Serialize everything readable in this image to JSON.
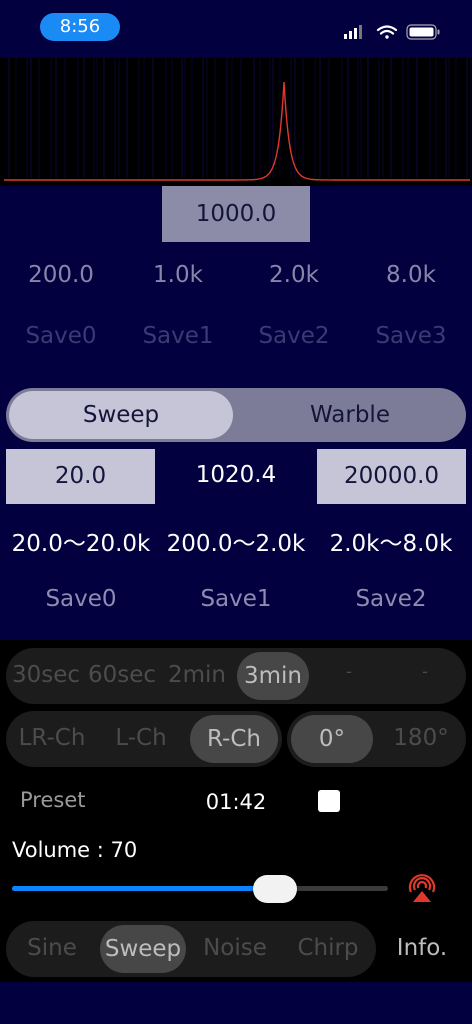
{
  "status": {
    "time": "8:56"
  },
  "spectrum": {
    "peak_frequency": 1000.0,
    "line_color": "#e0392b"
  },
  "tone": {
    "frequency": "1000.0",
    "presets": [
      "200.0",
      "1.0k",
      "2.0k",
      "8.0k"
    ],
    "saves": [
      "Save0",
      "Save1",
      "Save2",
      "Save3"
    ]
  },
  "sweep": {
    "tabs": [
      "Sweep",
      "Warble"
    ],
    "selected_tab": "Sweep",
    "start": "20.0",
    "current": "1020.4",
    "end": "20000.0",
    "ranges": [
      "20.0～20.0k",
      "200.0～2.0k",
      "2.0k～8.0k"
    ],
    "saves": [
      "Save0",
      "Save1",
      "Save2"
    ]
  },
  "duration": {
    "options": [
      "30sec",
      "60sec",
      "2min",
      "3min",
      "-",
      "-"
    ],
    "selected": "3min"
  },
  "channel": {
    "options": [
      "LR-Ch",
      "L-Ch",
      "R-Ch"
    ],
    "selected": "R-Ch"
  },
  "phase": {
    "options": [
      "0°",
      "180°"
    ],
    "selected": "0°"
  },
  "preset_label": "Preset",
  "timer": "01:42",
  "volume": {
    "label": "Volume : 70",
    "value": 70,
    "max": 100
  },
  "mode": {
    "options": [
      "Sine",
      "Sweep",
      "Noise",
      "Chirp"
    ],
    "selected": "Sweep"
  },
  "info_label": "Info.",
  "colors": {
    "accent": "#0b84ff",
    "navy": "#02003f",
    "airplay": "#e0392b"
  },
  "icons": [
    "signal-icon",
    "wifi-icon",
    "battery-icon",
    "airplay-icon",
    "stop-icon"
  ]
}
